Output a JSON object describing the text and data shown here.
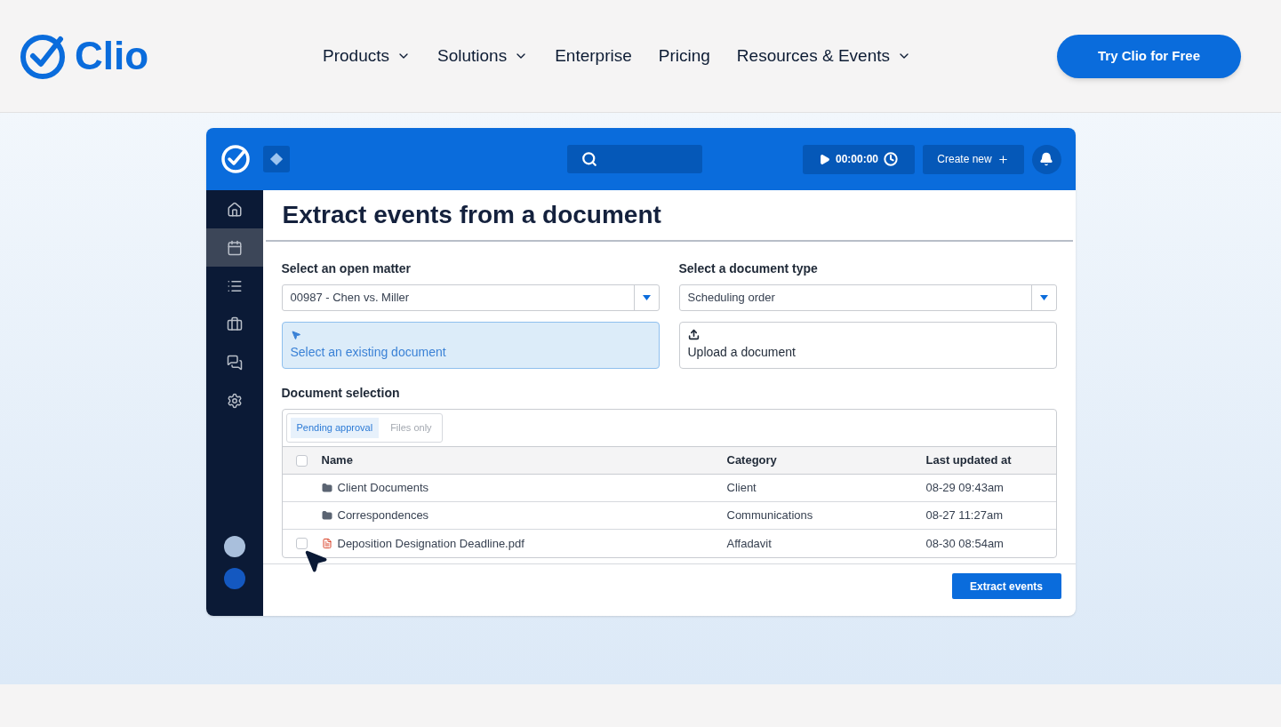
{
  "site_header": {
    "logo_text": "Clio",
    "nav": [
      {
        "label": "Products",
        "has_menu": true
      },
      {
        "label": "Solutions",
        "has_menu": true
      },
      {
        "label": "Enterprise",
        "has_menu": false
      },
      {
        "label": "Pricing",
        "has_menu": false
      },
      {
        "label": "Resources & Events",
        "has_menu": true
      }
    ],
    "cta": "Try Clio for Free"
  },
  "app": {
    "top_bar": {
      "timer": "00:00:00",
      "create_button": "Create new"
    },
    "sidebar": {
      "items": [
        {
          "kind": "home",
          "selected": false
        },
        {
          "kind": "calendar",
          "selected": true
        },
        {
          "kind": "list",
          "selected": false
        },
        {
          "kind": "briefcase",
          "selected": false
        },
        {
          "kind": "chat",
          "selected": false
        },
        {
          "kind": "settings",
          "selected": false
        }
      ]
    },
    "title": "Extract events from a document",
    "matter": {
      "label": "Select an open matter",
      "value": "00987 - Chen vs. Miller"
    },
    "document_type": {
      "label": "Select a document type",
      "value": "Scheduling order"
    },
    "source_options": [
      {
        "kind": "existing",
        "label": "Select an existing document",
        "selected": true
      },
      {
        "kind": "upload",
        "label": "Upload a document",
        "selected": false
      }
    ],
    "document_selection": {
      "label": "Document selection",
      "filters": [
        {
          "label": "Pending approval",
          "selected": true
        },
        {
          "label": "Files only",
          "selected": false
        }
      ],
      "select_all_checked": false,
      "columns": [
        "Name",
        "Category",
        "Last updated at"
      ],
      "rows": [
        {
          "kind": "folder",
          "name": "Client Documents",
          "category": "Client",
          "updated": "08-29 09:43am"
        },
        {
          "kind": "folder",
          "name": "Correspondences",
          "category": "Communications",
          "updated": "08-27 11:27am"
        },
        {
          "kind": "pdf",
          "name": "Deposition Designation Deadline.pdf",
          "category": "Affadavit",
          "updated": "08-30 08:54am",
          "checked": false
        }
      ]
    },
    "extract_button": "Extract events"
  }
}
